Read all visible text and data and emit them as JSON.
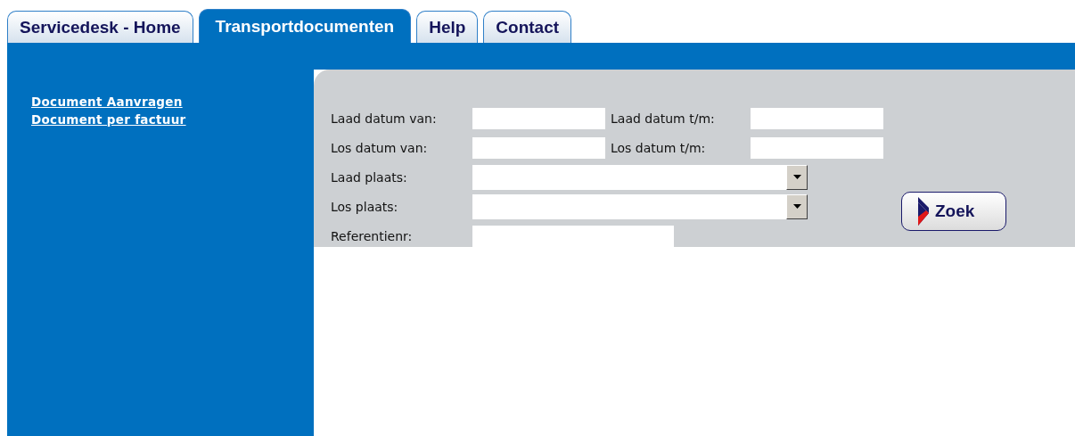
{
  "tabs": [
    {
      "label": "Servicedesk - Home",
      "selected": false
    },
    {
      "label": "Transportdocumenten",
      "selected": true
    },
    {
      "label": "Help",
      "selected": false
    },
    {
      "label": "Contact",
      "selected": false
    }
  ],
  "sidebar": {
    "links": [
      "Document Aanvragen",
      "Document per factuur"
    ]
  },
  "form": {
    "rows": [
      {
        "kind": "pair",
        "fields": [
          {
            "label": "Laad datum van:"
          },
          {
            "label": "Laad datum t/m:"
          }
        ]
      },
      {
        "kind": "pair",
        "fields": [
          {
            "label": "Los datum van:"
          },
          {
            "label": "Los datum t/m:"
          }
        ]
      },
      {
        "kind": "select",
        "fields": [
          {
            "label": "Laad plaats:"
          }
        ]
      },
      {
        "kind": "select",
        "fields": [
          {
            "label": "Los plaats:"
          }
        ]
      },
      {
        "kind": "text",
        "fields": [
          {
            "label": "Referentienr:"
          }
        ]
      }
    ],
    "search_button": "Zoek"
  }
}
